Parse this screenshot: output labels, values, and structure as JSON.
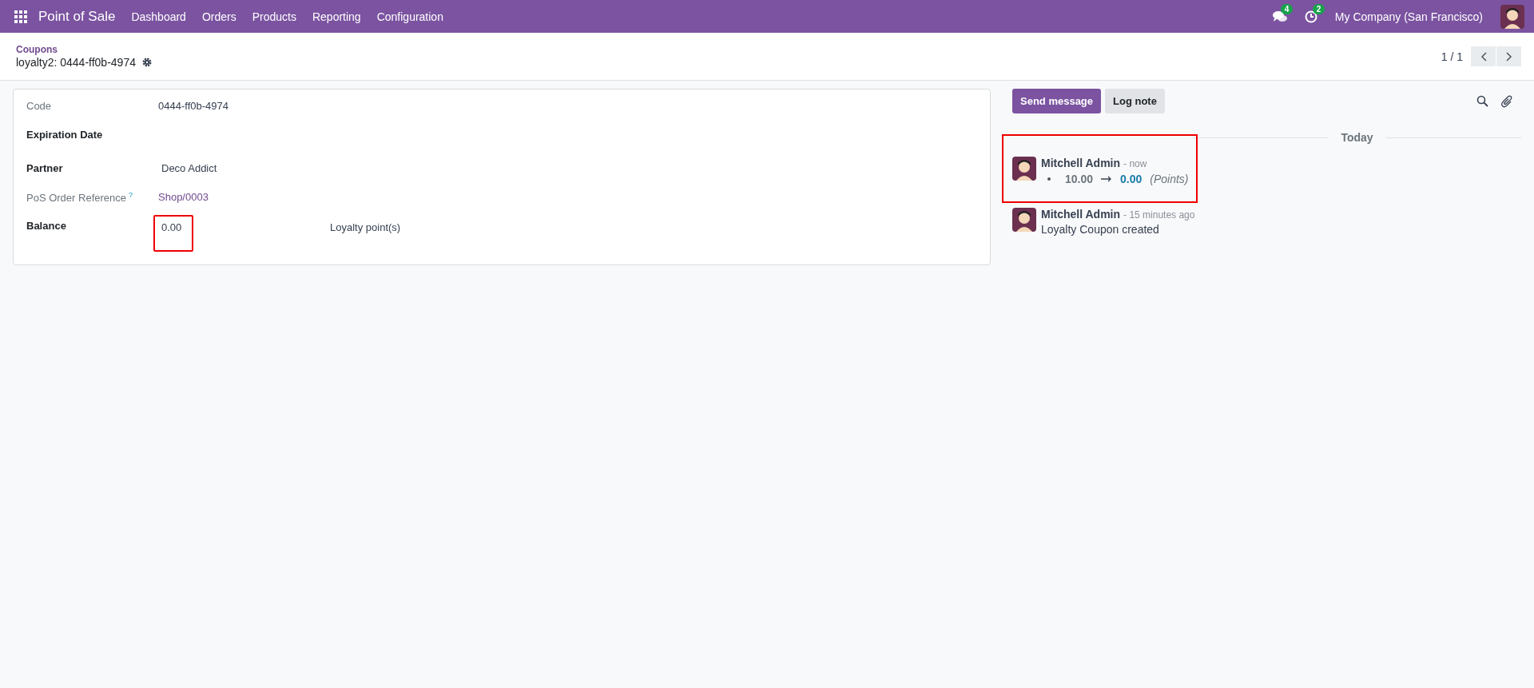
{
  "navbar": {
    "app_name": "Point of Sale",
    "menu": [
      "Dashboard",
      "Orders",
      "Products",
      "Reporting",
      "Configuration"
    ],
    "messages_count": "4",
    "activities_count": "2",
    "company": "My Company (San Francisco)"
  },
  "breadcrumb": {
    "parent": "Coupons",
    "record": "loyalty2: 0444-ff0b-4974"
  },
  "pager": {
    "value": "1 / 1"
  },
  "form": {
    "fields": [
      {
        "label": "Code",
        "required": false,
        "kind": "text",
        "value": "0444-ff0b-4974"
      },
      {
        "label": "Expiration Date",
        "required": true,
        "kind": "empty"
      },
      {
        "label": "Partner",
        "required": true,
        "kind": "text",
        "value": "Deco Addict"
      },
      {
        "label": "PoS Order Reference",
        "required": false,
        "kind": "link",
        "help": "?",
        "value": "Shop/0003"
      },
      {
        "label": "Balance",
        "required": true,
        "kind": "amount",
        "value": "0.00",
        "unit": "Loyalty point(s)",
        "highlighted": true
      }
    ]
  },
  "chatter": {
    "buttons": [
      {
        "label": "Send message",
        "primary": true
      },
      {
        "label": "Log note",
        "primary": false
      }
    ],
    "date_separator": "Today",
    "messages": [
      {
        "kind": "tracking",
        "author": "Mitchell Admin",
        "time": "- now",
        "old_value": "10.00",
        "new_value": "0.00",
        "field": "(Points)",
        "highlighted": true
      },
      {
        "kind": "text",
        "author": "Mitchell Admin",
        "time": "- 15 minutes ago",
        "body": "Loyalty Coupon created",
        "highlighted": false
      }
    ]
  }
}
